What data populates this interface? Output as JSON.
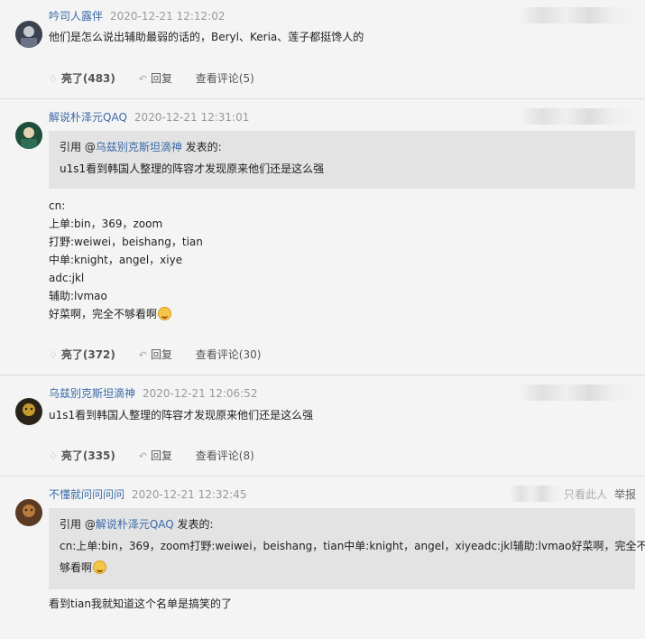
{
  "comments": [
    {
      "user": "吟司人露伴",
      "time": "2020-12-21 12:12:02",
      "body": "他们是怎么说出辅助最弱的话的，Beryl、Keria、莲子都挺馋人的",
      "likes": "亮了(483)",
      "reply": "回复",
      "view": "查看评论(5)"
    },
    {
      "user": "解说朴泽元QAQ",
      "time": "2020-12-21 12:31:01",
      "quote_prefix": "引用 @",
      "quote_user": "乌兹别克斯坦滴神",
      "quote_suffix": " 发表的:",
      "quote_text": "u1s1看到韩国人整理的阵容才发现原来他们还是这么强",
      "lines": [
        "cn:",
        "上单:bin，369，zoom",
        "打野:weiwei，beishang，tian",
        "中单:knight，angel，xiye",
        "adc:jkl",
        "辅助:lvmao",
        "好菜啊，完全不够看啊"
      ],
      "likes": "亮了(372)",
      "reply": "回复",
      "view": "查看评论(30)"
    },
    {
      "user": "乌兹别克斯坦滴神",
      "time": "2020-12-21 12:06:52",
      "body": "u1s1看到韩国人整理的阵容才发现原来他们还是这么强",
      "likes": "亮了(335)",
      "reply": "回复",
      "view": "查看评论(8)"
    },
    {
      "user": "不懂就问问问问",
      "time": "2020-12-21 12:32:45",
      "ext_partial": "只看此人",
      "ext_report": "举报",
      "quote_prefix": "引用 @",
      "quote_user": "解说朴泽元QAQ",
      "quote_suffix": " 发表的:",
      "quote_line1": "cn:上单:bin，369，zoom打野:weiwei，beishang，tian中单:knight，angel，xiyeadc:jkl辅助:lvmao好菜啊，完全不",
      "quote_line2": "够看啊",
      "body": "看到tian我就知道这个名单是搞笑的了"
    }
  ],
  "icons": {
    "like": "thumb-icon",
    "reply": "reply-icon",
    "emoji": "laugh-emoji-icon"
  }
}
